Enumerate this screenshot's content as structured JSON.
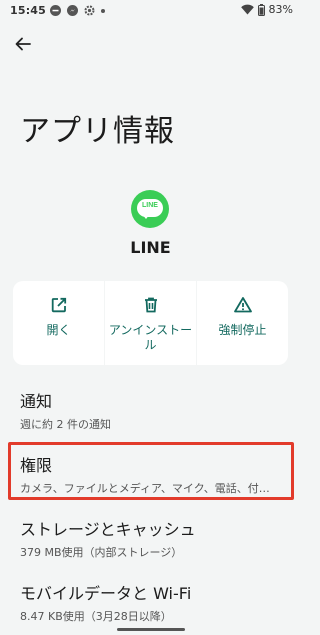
{
  "status_bar": {
    "time": "15:45",
    "battery_percent": "83%",
    "icons": [
      "minus-circle-icon",
      "messenger-icon",
      "gear-icon",
      "dot-icon",
      "wifi-icon",
      "battery-icon"
    ]
  },
  "header": {
    "title": "アプリ情報"
  },
  "app": {
    "icon_text": "LINE",
    "name": "LINE",
    "brand_color": "#3acd56"
  },
  "actions": [
    {
      "label": "開く",
      "icon": "open-external-icon"
    },
    {
      "label": "アンインストール",
      "icon": "trash-icon"
    },
    {
      "label": "強制停止",
      "icon": "warning-icon"
    }
  ],
  "items": [
    {
      "title": "通知",
      "subtitle": "週に約 2 件の通知"
    },
    {
      "title": "権限",
      "subtitle": "カメラ、ファイルとメディア、マイク、電話、付…"
    },
    {
      "title": "ストレージとキャッシュ",
      "subtitle": "379 MB使用（内部ストレージ）"
    },
    {
      "title": "モバイルデータと Wi-Fi",
      "subtitle": "8.47 KB使用（3月28日以降）"
    }
  ],
  "colors": {
    "accent": "#13695f",
    "highlight": "#e23b2b",
    "background": "#f3f5f5"
  }
}
